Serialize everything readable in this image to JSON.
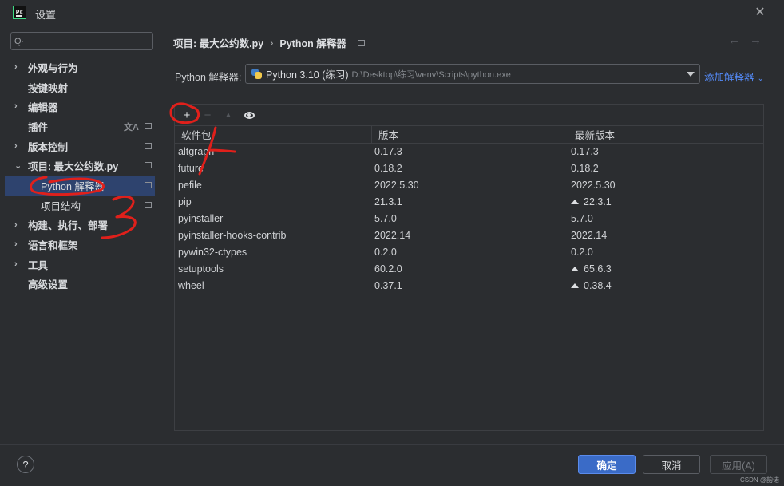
{
  "window": {
    "title": "设置"
  },
  "search": {
    "value": "",
    "placeholder": ""
  },
  "sidebar": {
    "items": [
      {
        "label": "外观与行为",
        "arrow": "›"
      },
      {
        "label": "按键映射"
      },
      {
        "label": "编辑器",
        "arrow": "›"
      },
      {
        "label": "插件"
      },
      {
        "label": "版本控制",
        "arrow": "›"
      },
      {
        "label": "项目: 最大公约数.py",
        "arrow": "⌄"
      },
      {
        "label": "Python 解释器"
      },
      {
        "label": "项目结构"
      },
      {
        "label": "构建、执行、部署",
        "arrow": "›"
      },
      {
        "label": "语言和框架",
        "arrow": "›"
      },
      {
        "label": "工具",
        "arrow": "›"
      },
      {
        "label": "高级设置"
      }
    ]
  },
  "breadcrumb": {
    "project": "项目: 最大公约数.py",
    "sep": "›",
    "page": "Python 解释器"
  },
  "interpreter": {
    "label": "Python 解释器:",
    "name": "Python 3.10 (练习)",
    "path": "D:\\Desktop\\练习\\venv\\Scripts\\python.exe",
    "add_label": "添加解释器"
  },
  "table": {
    "columns": [
      "软件包",
      "版本",
      "最新版本"
    ],
    "rows": [
      {
        "name": "altgraph",
        "version": "0.17.3",
        "latest": "0.17.3",
        "upgrade": false
      },
      {
        "name": "future",
        "version": "0.18.2",
        "latest": "0.18.2",
        "upgrade": false
      },
      {
        "name": "pefile",
        "version": "2022.5.30",
        "latest": "2022.5.30",
        "upgrade": false
      },
      {
        "name": "pip",
        "version": "21.3.1",
        "latest": "22.3.1",
        "upgrade": true
      },
      {
        "name": "pyinstaller",
        "version": "5.7.0",
        "latest": "5.7.0",
        "upgrade": false
      },
      {
        "name": "pyinstaller-hooks-contrib",
        "version": "2022.14",
        "latest": "2022.14",
        "upgrade": false
      },
      {
        "name": "pywin32-ctypes",
        "version": "0.2.0",
        "latest": "0.2.0",
        "upgrade": false
      },
      {
        "name": "setuptools",
        "version": "60.2.0",
        "latest": "65.6.3",
        "upgrade": true
      },
      {
        "name": "wheel",
        "version": "0.37.1",
        "latest": "0.38.4",
        "upgrade": true
      }
    ]
  },
  "footer": {
    "help": "?",
    "ok": "确定",
    "cancel": "取消",
    "apply": "应用(A)",
    "watermark": "CSDN @韵诺"
  },
  "annotations": {
    "color": "#e0201b",
    "labels": [
      "1",
      "2",
      "3"
    ]
  },
  "colors": {
    "accent": "#3a6bc7",
    "link": "#548af7",
    "selected": "#2e436e"
  },
  "icons": [
    "app-logo-icon",
    "close-icon",
    "search-icon",
    "chevron-right-icon",
    "chevron-down-icon",
    "settings-badge-icon",
    "translate-icon",
    "python-icon",
    "add-icon",
    "remove-icon",
    "upgrade-icon",
    "eye-icon",
    "back-arrow-icon",
    "forward-arrow-icon",
    "help-icon"
  ]
}
